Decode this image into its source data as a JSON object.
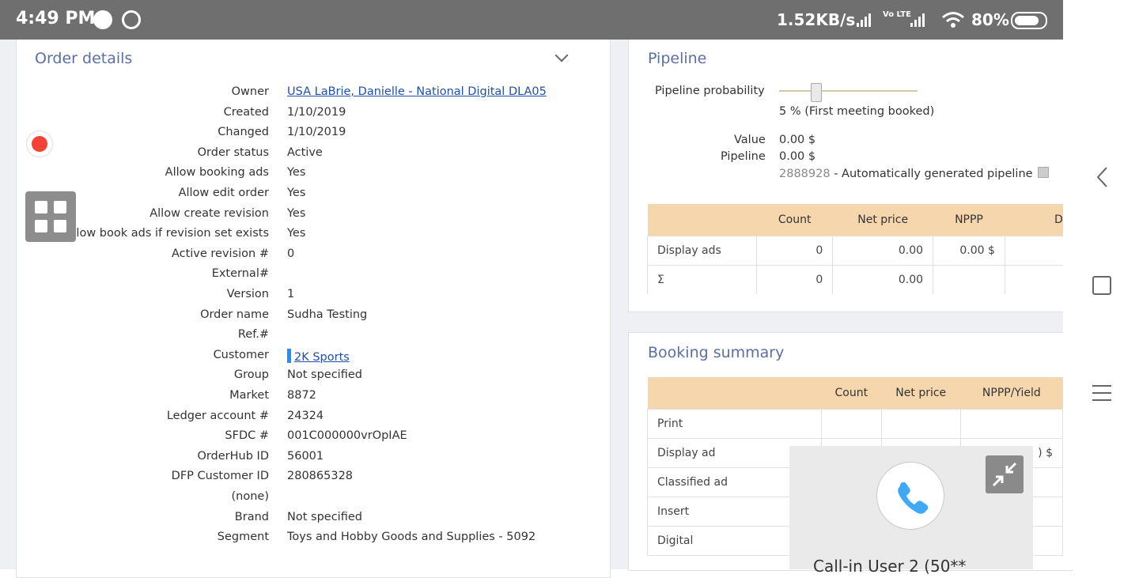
{
  "status_bar": {
    "time": "4:49 PM",
    "network_speed": "1.52KB/s",
    "lte_label": "Vo LTE",
    "battery": "80%"
  },
  "order_details": {
    "title": "Order details",
    "fields": [
      {
        "label": "Owner",
        "value": "USA LaBrie, Danielle - National Digital DLA05",
        "link": true
      },
      {
        "label": "Created",
        "value": "1/10/2019"
      },
      {
        "label": "Changed",
        "value": "1/10/2019"
      },
      {
        "label": "Order status",
        "value": "Active"
      },
      {
        "label": "Allow booking ads",
        "value": "Yes"
      },
      {
        "label": "Allow edit order",
        "value": "Yes"
      },
      {
        "label": "Allow create revision",
        "value": "Yes"
      },
      {
        "label": "Allow book ads if revision set exists",
        "value": "Yes"
      },
      {
        "label": "Active revision #",
        "value": "0"
      },
      {
        "label": "External#",
        "value": ""
      },
      {
        "label": "Version",
        "value": "1"
      },
      {
        "label": "Order name",
        "value": "Sudha Testing"
      },
      {
        "label": "Ref.#",
        "value": ""
      },
      {
        "label": "Customer",
        "value": "2K Sports",
        "link": true
      },
      {
        "label": "Group",
        "value": "Not specified"
      },
      {
        "label": "Market",
        "value": "8872"
      },
      {
        "label": "Ledger account #",
        "value": "24324"
      },
      {
        "label": "SFDC #",
        "value": "001C000000vrOpIAE"
      },
      {
        "label": "OrderHub ID",
        "value": "56001"
      },
      {
        "label": "DFP Customer ID",
        "value": "280865328"
      },
      {
        "label": "(none)",
        "value": ""
      },
      {
        "label": "Brand",
        "value": "Not specified"
      },
      {
        "label": "Segment",
        "value": "Toys and Hobby Goods and Supplies - 5092"
      }
    ]
  },
  "pipeline": {
    "title": "Pipeline",
    "probability_label": "Pipeline probability",
    "probability_text": "5 % (First meeting booked)",
    "probability_value": 0.05,
    "value_label": "Value",
    "value": "0.00 $",
    "pipeline_label": "Pipeline",
    "pipeline_value": "0.00 $",
    "pipeline_id": "2888928",
    "pipeline_desc": "- Automatically generated pipeline",
    "table": {
      "headers": [
        "",
        "Count",
        "Net price",
        "NPPP",
        "Dis"
      ],
      "rows": [
        [
          "Display ads",
          "0",
          "0.00",
          "0.00 $",
          ""
        ],
        [
          "Σ",
          "0",
          "0.00",
          "",
          ""
        ]
      ]
    }
  },
  "booking_summary": {
    "title": "Booking summary",
    "table": {
      "headers": [
        "",
        "Count",
        "Net price",
        "NPPP/Yield"
      ],
      "rows": [
        [
          "Print",
          "",
          "",
          ""
        ],
        [
          "Display ad",
          "",
          "",
          ") $"
        ],
        [
          "Classified ad",
          "",
          "",
          ""
        ],
        [
          "Insert",
          "",
          "",
          ""
        ],
        [
          "Digital",
          "",
          "",
          ""
        ]
      ]
    }
  },
  "call_widget": {
    "caller": "Call-in User  2 (50**"
  },
  "icons": {
    "record": "record-icon",
    "apps": "grid-icon",
    "phone": "phone-icon",
    "minimize": "minimize-icon",
    "back": "back-icon",
    "home": "home-icon",
    "menu": "menu-icon"
  },
  "colors": {
    "accent": "#5b6fa6",
    "table_header": "#f6d6ad",
    "link": "#1f4fa8",
    "record": "#f44336"
  }
}
